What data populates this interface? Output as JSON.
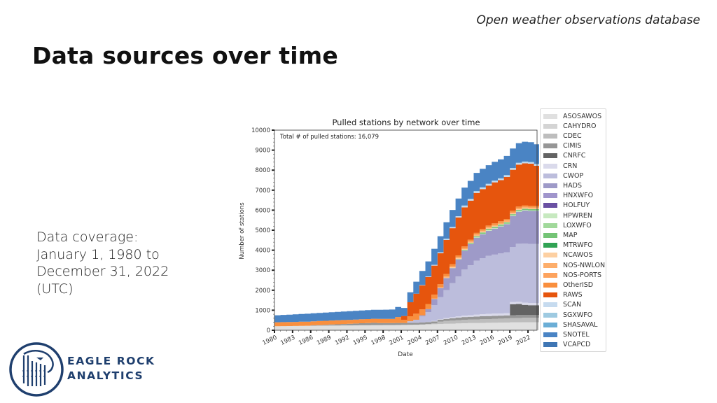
{
  "header": {
    "subtitle": "Open weather observations database",
    "title": "Data sources over time"
  },
  "coverage": {
    "lines": [
      "Data coverage:",
      "January 1, 1980 to",
      "December 31, 2022",
      "(UTC)"
    ]
  },
  "logo": {
    "line1": "EAGLE ROCK",
    "line2": "ANALYTICS",
    "color": "#1f3f6e"
  },
  "chart_data": {
    "type": "area",
    "stacked": true,
    "title": "Pulled stations by network over time",
    "annotation": "Total # of pulled stations: 16,079",
    "xlabel": "Date",
    "ylabel": "Number of stations",
    "xlim": [
      1980,
      2023.5
    ],
    "ylim": [
      0,
      10000
    ],
    "yticks": [
      0,
      1000,
      2000,
      3000,
      4000,
      5000,
      6000,
      7000,
      8000,
      9000,
      10000
    ],
    "xticks": [
      "1980",
      "1983",
      "1986",
      "1989",
      "1992",
      "1995",
      "1998",
      "2001",
      "2004",
      "2007",
      "2010",
      "2013",
      "2016",
      "2019",
      "2022"
    ],
    "legend_position": "right-outside",
    "grid": false,
    "x": [
      1980,
      1981,
      1982,
      1983,
      1984,
      1985,
      1986,
      1987,
      1988,
      1989,
      1990,
      1991,
      1992,
      1993,
      1994,
      1995,
      1996,
      1997,
      1998,
      1999,
      2000,
      2001,
      2002,
      2003,
      2004,
      2005,
      2006,
      2007,
      2008,
      2009,
      2010,
      2011,
      2012,
      2013,
      2014,
      2015,
      2016,
      2017,
      2018,
      2019,
      2020,
      2021,
      2022,
      2023
    ],
    "series": [
      {
        "name": "ASOSAWOS",
        "color": "#e0e0e0",
        "values": [
          200,
          205,
          210,
          215,
          220,
          225,
          228,
          230,
          232,
          235,
          238,
          240,
          242,
          245,
          248,
          250,
          252,
          255,
          258,
          260,
          262,
          265,
          270,
          275,
          280,
          290,
          300,
          310,
          320,
          330,
          340,
          350,
          355,
          360,
          365,
          370,
          375,
          380,
          385,
          390,
          395,
          400,
          400,
          400
        ]
      },
      {
        "name": "CAHYDRO",
        "color": "#d4d4d4",
        "values": [
          0,
          0,
          0,
          0,
          0,
          0,
          0,
          0,
          0,
          0,
          0,
          0,
          0,
          0,
          0,
          0,
          0,
          0,
          0,
          0,
          0,
          0,
          0,
          0,
          0,
          0,
          0,
          0,
          0,
          0,
          0,
          0,
          0,
          0,
          0,
          0,
          0,
          0,
          0,
          0,
          0,
          0,
          0,
          0
        ]
      },
      {
        "name": "CDEC",
        "color": "#bdbdbd",
        "values": [
          0,
          0,
          0,
          0,
          0,
          0,
          0,
          0,
          0,
          0,
          0,
          0,
          0,
          0,
          0,
          0,
          0,
          0,
          0,
          0,
          0,
          0,
          0,
          0,
          10,
          20,
          40,
          120,
          140,
          150,
          160,
          170,
          175,
          180,
          185,
          190,
          195,
          200,
          205,
          210,
          215,
          220,
          220,
          220
        ]
      },
      {
        "name": "CIMIS",
        "color": "#969696",
        "values": [
          0,
          0,
          0,
          0,
          0,
          0,
          20,
          30,
          40,
          50,
          60,
          70,
          80,
          90,
          100,
          110,
          120,
          100,
          100,
          100,
          100,
          100,
          100,
          100,
          100,
          100,
          100,
          100,
          110,
          120,
          130,
          140,
          140,
          145,
          150,
          150,
          150,
          150,
          150,
          150,
          150,
          150,
          150,
          150
        ]
      },
      {
        "name": "CNRFC",
        "color": "#636363",
        "values": [
          0,
          0,
          0,
          0,
          0,
          0,
          0,
          0,
          0,
          0,
          0,
          0,
          0,
          0,
          0,
          0,
          0,
          0,
          0,
          0,
          0,
          0,
          0,
          0,
          0,
          0,
          0,
          0,
          0,
          0,
          0,
          0,
          0,
          0,
          0,
          0,
          0,
          0,
          0,
          550,
          550,
          500,
          480,
          480
        ]
      },
      {
        "name": "CRN",
        "color": "#dadaeb",
        "values": [
          0,
          0,
          0,
          0,
          0,
          0,
          0,
          0,
          0,
          0,
          0,
          0,
          0,
          0,
          0,
          0,
          0,
          0,
          0,
          0,
          0,
          0,
          0,
          0,
          0,
          0,
          20,
          30,
          40,
          50,
          60,
          70,
          80,
          90,
          100,
          110,
          110,
          110,
          110,
          110,
          110,
          110,
          110,
          110
        ]
      },
      {
        "name": "CWOP",
        "color": "#bcbddc",
        "values": [
          0,
          0,
          0,
          0,
          0,
          0,
          0,
          0,
          0,
          0,
          0,
          0,
          0,
          0,
          0,
          0,
          0,
          0,
          0,
          0,
          0,
          0,
          80,
          150,
          300,
          500,
          800,
          1100,
          1400,
          1700,
          2000,
          2300,
          2500,
          2700,
          2800,
          2900,
          2950,
          3000,
          3050,
          2750,
          2900,
          2950,
          2950,
          2950
        ]
      },
      {
        "name": "HADS",
        "color": "#9e9ac8",
        "values": [
          0,
          0,
          0,
          0,
          0,
          0,
          0,
          0,
          0,
          0,
          0,
          0,
          0,
          0,
          0,
          0,
          0,
          0,
          0,
          0,
          0,
          0,
          0,
          0,
          50,
          150,
          300,
          450,
          600,
          750,
          850,
          950,
          1050,
          1150,
          1200,
          1250,
          1300,
          1350,
          1400,
          1550,
          1600,
          1650,
          1650,
          1650
        ]
      },
      {
        "name": "HNXWFO",
        "color": "#a095cc",
        "values": [
          0,
          0,
          0,
          0,
          0,
          0,
          0,
          0,
          0,
          0,
          0,
          0,
          0,
          0,
          0,
          0,
          0,
          0,
          0,
          0,
          0,
          0,
          0,
          0,
          0,
          0,
          0,
          0,
          0,
          0,
          0,
          0,
          0,
          0,
          0,
          0,
          0,
          0,
          0,
          0,
          0,
          0,
          0,
          0
        ]
      },
      {
        "name": "HOLFUY",
        "color": "#6a51a3",
        "values": [
          0,
          0,
          0,
          0,
          0,
          0,
          0,
          0,
          0,
          0,
          0,
          0,
          0,
          0,
          0,
          0,
          0,
          0,
          0,
          0,
          0,
          0,
          0,
          0,
          0,
          0,
          0,
          0,
          0,
          0,
          0,
          0,
          0,
          0,
          0,
          0,
          0,
          0,
          0,
          0,
          0,
          0,
          0,
          0
        ]
      },
      {
        "name": "HPWREN",
        "color": "#c7e9c0",
        "values": [
          0,
          0,
          0,
          0,
          0,
          0,
          0,
          0,
          0,
          0,
          0,
          0,
          0,
          0,
          0,
          0,
          0,
          0,
          0,
          0,
          0,
          0,
          0,
          0,
          0,
          0,
          0,
          0,
          0,
          0,
          0,
          10,
          15,
          20,
          25,
          30,
          30,
          30,
          30,
          30,
          30,
          30,
          30,
          30
        ]
      },
      {
        "name": "LOXWFO",
        "color": "#a1d99b",
        "values": [
          0,
          0,
          0,
          0,
          0,
          0,
          0,
          0,
          0,
          0,
          0,
          0,
          0,
          0,
          0,
          0,
          0,
          0,
          0,
          0,
          0,
          0,
          0,
          0,
          0,
          0,
          0,
          0,
          0,
          0,
          0,
          0,
          0,
          0,
          0,
          0,
          0,
          0,
          0,
          0,
          0,
          0,
          0,
          0
        ]
      },
      {
        "name": "MAP",
        "color": "#74c476",
        "values": [
          0,
          0,
          0,
          0,
          0,
          0,
          0,
          0,
          0,
          0,
          0,
          0,
          0,
          0,
          0,
          0,
          0,
          0,
          0,
          0,
          0,
          0,
          0,
          0,
          0,
          0,
          0,
          0,
          0,
          10,
          20,
          30,
          40,
          50,
          60,
          60,
          60,
          60,
          60,
          60,
          60,
          60,
          60,
          60
        ]
      },
      {
        "name": "MTRWFO",
        "color": "#31a354",
        "values": [
          0,
          0,
          0,
          0,
          0,
          0,
          0,
          0,
          0,
          0,
          0,
          0,
          0,
          0,
          0,
          0,
          0,
          0,
          0,
          0,
          0,
          0,
          0,
          0,
          0,
          0,
          0,
          0,
          0,
          0,
          0,
          0,
          0,
          0,
          0,
          0,
          0,
          0,
          0,
          0,
          0,
          0,
          0,
          0
        ]
      },
      {
        "name": "NCAWOS",
        "color": "#fdd0a2",
        "values": [
          0,
          0,
          0,
          0,
          0,
          0,
          0,
          0,
          0,
          0,
          0,
          0,
          0,
          0,
          0,
          0,
          0,
          0,
          0,
          0,
          0,
          0,
          0,
          0,
          0,
          0,
          0,
          0,
          20,
          30,
          30,
          30,
          30,
          30,
          30,
          30,
          30,
          30,
          30,
          30,
          30,
          30,
          30,
          30
        ]
      },
      {
        "name": "NOS-NWLON",
        "color": "#fdae6b",
        "values": [
          0,
          0,
          0,
          0,
          0,
          0,
          0,
          0,
          0,
          0,
          0,
          0,
          0,
          0,
          0,
          0,
          0,
          0,
          0,
          0,
          0,
          0,
          0,
          0,
          0,
          0,
          20,
          30,
          40,
          40,
          40,
          40,
          40,
          40,
          40,
          40,
          40,
          40,
          40,
          40,
          40,
          40,
          40,
          40
        ]
      },
      {
        "name": "NOS-PORTS",
        "color": "#fda35e",
        "values": [
          0,
          0,
          0,
          0,
          0,
          0,
          0,
          0,
          0,
          0,
          0,
          0,
          0,
          0,
          0,
          0,
          0,
          0,
          0,
          0,
          0,
          0,
          0,
          0,
          0,
          0,
          0,
          10,
          20,
          20,
          20,
          20,
          20,
          20,
          20,
          20,
          20,
          20,
          20,
          20,
          20,
          20,
          20,
          20
        ]
      },
      {
        "name": "OtherISD",
        "color": "#f98f3e",
        "values": [
          200,
          200,
          200,
          200,
          205,
          205,
          200,
          200,
          200,
          200,
          200,
          200,
          200,
          200,
          200,
          200,
          200,
          210,
          210,
          210,
          300,
          150,
          250,
          300,
          300,
          250,
          200,
          150,
          120,
          100,
          90,
          80,
          80,
          80,
          80,
          80,
          80,
          80,
          80,
          80,
          80,
          80,
          80,
          80
        ]
      },
      {
        "name": "RAWS",
        "color": "#e6550d",
        "values": [
          0,
          0,
          0,
          0,
          0,
          0,
          0,
          0,
          0,
          0,
          0,
          0,
          0,
          0,
          0,
          0,
          0,
          0,
          0,
          0,
          0,
          200,
          700,
          1000,
          1200,
          1350,
          1450,
          1550,
          1700,
          1800,
          1900,
          1950,
          1950,
          2000,
          2000,
          2000,
          2050,
          2050,
          2100,
          2050,
          2100,
          2100,
          2100,
          2000
        ]
      },
      {
        "name": "SCAN",
        "color": "#c6dbef",
        "values": [
          0,
          0,
          0,
          0,
          0,
          0,
          0,
          0,
          0,
          0,
          0,
          0,
          0,
          0,
          0,
          0,
          0,
          0,
          0,
          0,
          0,
          0,
          0,
          0,
          20,
          30,
          40,
          50,
          60,
          60,
          60,
          70,
          70,
          70,
          70,
          70,
          70,
          70,
          70,
          70,
          70,
          70,
          70,
          70
        ]
      },
      {
        "name": "SGXWFO",
        "color": "#9ecae1",
        "values": [
          0,
          0,
          0,
          0,
          0,
          0,
          0,
          0,
          0,
          0,
          0,
          0,
          0,
          0,
          0,
          0,
          0,
          0,
          0,
          0,
          0,
          0,
          0,
          0,
          0,
          0,
          0,
          0,
          0,
          0,
          0,
          20,
          20,
          20,
          20,
          20,
          20,
          20,
          20,
          20,
          20,
          20,
          20,
          20
        ]
      },
      {
        "name": "SHASAVAL",
        "color": "#6baed6",
        "values": [
          0,
          0,
          0,
          0,
          0,
          0,
          0,
          0,
          0,
          0,
          0,
          0,
          0,
          0,
          0,
          0,
          0,
          0,
          0,
          0,
          0,
          0,
          0,
          0,
          0,
          0,
          0,
          0,
          0,
          0,
          0,
          0,
          0,
          0,
          0,
          0,
          0,
          0,
          0,
          0,
          0,
          0,
          0,
          0
        ]
      },
      {
        "name": "SNOTEL",
        "color": "#4a84c4",
        "values": [
          350,
          360,
          370,
          380,
          390,
          395,
          400,
          405,
          410,
          415,
          420,
          425,
          430,
          435,
          440,
          445,
          450,
          455,
          460,
          465,
          500,
          400,
          500,
          600,
          700,
          750,
          800,
          800,
          830,
          850,
          880,
          900,
          900,
          910,
          920,
          930,
          940,
          950,
          960,
          970,
          980,
          990,
          990,
          980
        ]
      },
      {
        "name": "VCAPCD",
        "color": "#3f76b4",
        "values": [
          0,
          0,
          0,
          0,
          0,
          0,
          0,
          0,
          0,
          0,
          0,
          0,
          0,
          0,
          0,
          0,
          0,
          0,
          0,
          0,
          0,
          0,
          0,
          0,
          0,
          0,
          0,
          0,
          0,
          0,
          0,
          0,
          0,
          0,
          0,
          0,
          0,
          0,
          0,
          0,
          0,
          0,
          0,
          0
        ]
      }
    ]
  }
}
